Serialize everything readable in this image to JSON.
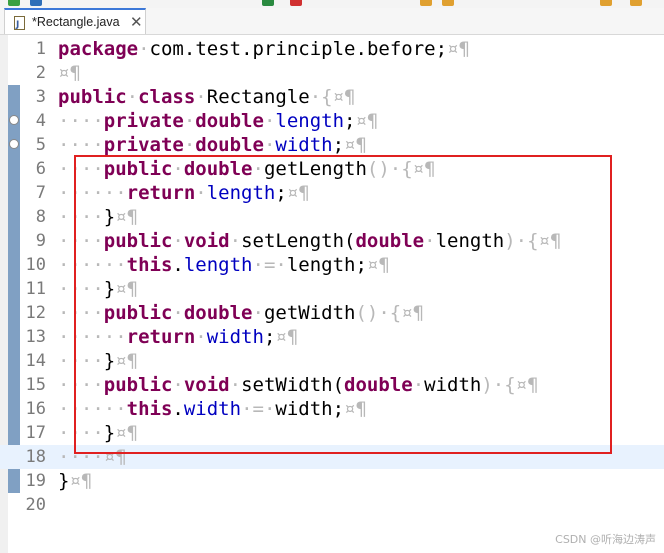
{
  "tab": {
    "title": "*Rectangle.java",
    "close_glyph": "✕"
  },
  "whitespace": {
    "tab_dots": "····",
    "indent_dots": "······",
    "eol": "¤¶"
  },
  "lines": [
    {
      "num": "1",
      "text": "package com.test.principle.before;"
    },
    {
      "num": "2",
      "text": ""
    },
    {
      "num": "3",
      "text": "public class Rectangle {"
    },
    {
      "num": "4",
      "text": "private double length;"
    },
    {
      "num": "5",
      "text": "private double width;"
    },
    {
      "num": "6",
      "text": "public double getLength() {"
    },
    {
      "num": "7",
      "text": "return length;"
    },
    {
      "num": "8",
      "text": "}"
    },
    {
      "num": "9",
      "text": "public void setLength(double length) {"
    },
    {
      "num": "10",
      "text": "this.length = length;"
    },
    {
      "num": "11",
      "text": "}"
    },
    {
      "num": "12",
      "text": "public double getWidth() {"
    },
    {
      "num": "13",
      "text": "return width;"
    },
    {
      "num": "14",
      "text": "}"
    },
    {
      "num": "15",
      "text": "public void setWidth(double width) {"
    },
    {
      "num": "16",
      "text": "this.width = width;"
    },
    {
      "num": "17",
      "text": "}"
    },
    {
      "num": "18",
      "text": ""
    },
    {
      "num": "19",
      "text": "}"
    },
    {
      "num": "20",
      "text": ""
    }
  ],
  "colors": {
    "keyword": "#7f0055",
    "field": "#0000c0",
    "highlight_box": "#e02020",
    "current_line": "#e8f2fe"
  },
  "watermark": "CSDN @听海边涛声"
}
